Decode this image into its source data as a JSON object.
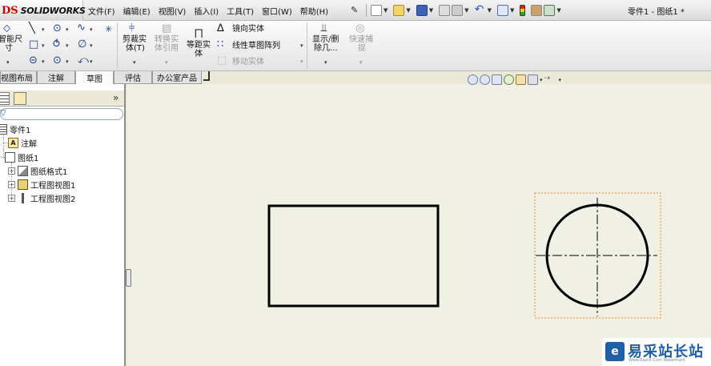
{
  "app": {
    "logo_mark": "DS",
    "logo_text": "SOLIDWORKS",
    "document_title": "零件1 - 图纸1 *"
  },
  "menu": {
    "items": [
      "文件(F)",
      "编辑(E)",
      "视图(V)",
      "插入(I)",
      "工具(T)",
      "窗口(W)",
      "帮助(H)"
    ]
  },
  "commands": {
    "smart_dimension": [
      "智能尺",
      "寸"
    ],
    "trim_entities": [
      "剪裁实",
      "体(T)"
    ],
    "convert_entities": [
      "转换实",
      "体引用"
    ],
    "offset_entities": [
      "等距实",
      "体"
    ],
    "mirror_entities": "镜向实体",
    "linear_pattern": "线性草图阵列",
    "move_entities": "移动实体",
    "display_relations": [
      "显示/删",
      "除几..."
    ],
    "quick_snaps": [
      "快速捕",
      "捉"
    ]
  },
  "tabs": [
    "视图布局",
    "注解",
    "草图",
    "评估",
    "办公室产品"
  ],
  "active_tab": "草图",
  "tree": {
    "collapse_glyph": "»",
    "root": "零件1",
    "annotations": "注解",
    "sheet": "图纸1",
    "children": [
      "图纸格式1",
      "工程图视图1",
      "工程图视图2"
    ],
    "annotation_icon": "A"
  },
  "watermark": {
    "badge": "e",
    "name": "易采站长站",
    "sub": "Www.Easck.Com  Watermark"
  },
  "colors": {
    "canvas": "#f0f0e4",
    "accent": "#1f5fa8",
    "selection_box": "#e08a3c"
  },
  "icons": [
    "smart-dimension-icon",
    "line-icon",
    "circle-icon",
    "spline-icon",
    "rectangle-icon",
    "trim-icon",
    "mirror-icon",
    "zoom-icon",
    "rotate-icon"
  ]
}
